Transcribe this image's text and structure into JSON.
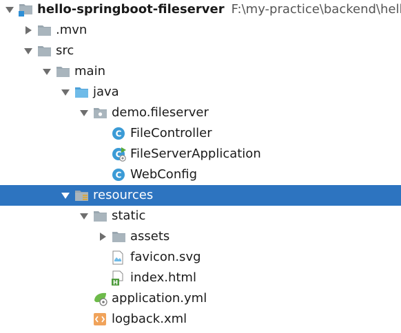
{
  "project_view": {
    "selected_index": 9,
    "nodes": [
      {
        "label": "hello-springboot-fileserver",
        "path": "F:\\my-practice\\backend\\hello",
        "icon": "module-folder-icon",
        "expand": "expanded",
        "depth": 0,
        "bold": true
      },
      {
        "label": ".mvn",
        "icon": "folder-icon",
        "expand": "collapsed",
        "depth": 1
      },
      {
        "label": "src",
        "icon": "folder-icon",
        "expand": "expanded",
        "depth": 1
      },
      {
        "label": "main",
        "icon": "folder-icon",
        "expand": "expanded",
        "depth": 2
      },
      {
        "label": "java",
        "icon": "source-folder-icon",
        "expand": "expanded",
        "depth": 3
      },
      {
        "label": "demo.fileserver",
        "icon": "package-icon",
        "expand": "expanded",
        "depth": 4
      },
      {
        "label": "FileController",
        "icon": "java-class-icon",
        "expand": "none",
        "depth": 5
      },
      {
        "label": "FileServerApplication",
        "icon": "spring-boot-class-icon",
        "expand": "none",
        "depth": 5
      },
      {
        "label": "WebConfig",
        "icon": "java-class-icon",
        "expand": "none",
        "depth": 5
      },
      {
        "label": "resources",
        "icon": "resources-folder-icon",
        "expand": "expanded",
        "depth": 3
      },
      {
        "label": "static",
        "icon": "folder-icon",
        "expand": "expanded",
        "depth": 4
      },
      {
        "label": "assets",
        "icon": "folder-icon",
        "expand": "collapsed",
        "depth": 5
      },
      {
        "label": "favicon.svg",
        "icon": "svg-file-icon",
        "expand": "none",
        "depth": 5
      },
      {
        "label": "index.html",
        "icon": "html-file-icon",
        "expand": "none",
        "depth": 5
      },
      {
        "label": "application.yml",
        "icon": "spring-yml-icon",
        "expand": "none",
        "depth": 4
      },
      {
        "label": "logback.xml",
        "icon": "xml-file-icon",
        "expand": "none",
        "depth": 4
      }
    ]
  }
}
